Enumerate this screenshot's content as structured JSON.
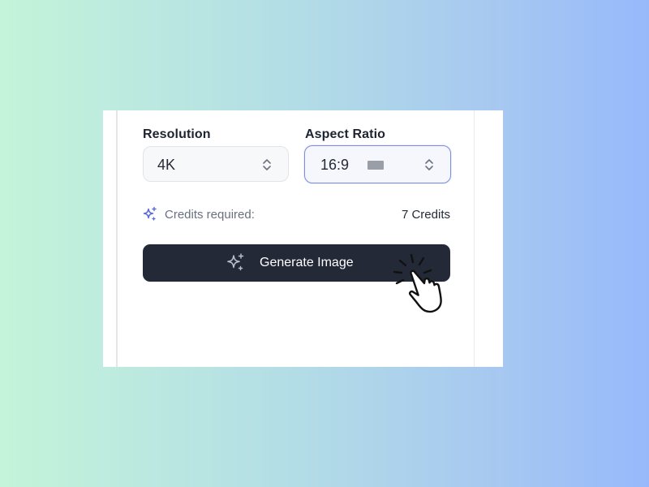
{
  "settings": {
    "resolution": {
      "label": "Resolution",
      "value": "4K",
      "icon": "chevron-up-down-icon"
    },
    "aspect_ratio": {
      "label": "Aspect Ratio",
      "value": "16:9",
      "icon": "chevron-up-down-icon",
      "focused": true
    },
    "credits": {
      "icon": "sparkle-icon",
      "label": "Credits required:",
      "value": "7 Credits"
    }
  },
  "generate_button": {
    "label": "Generate Image",
    "icon": "sparkle-icon"
  },
  "cursor": {
    "icon": "pointing-hand-click-icon"
  },
  "colors": {
    "button_bg": "#232937",
    "focus_border": "#7d8ee0",
    "credits_icon": "#5b6bd6",
    "background_start": "#c4f4d9",
    "background_end": "#97b9fb"
  }
}
